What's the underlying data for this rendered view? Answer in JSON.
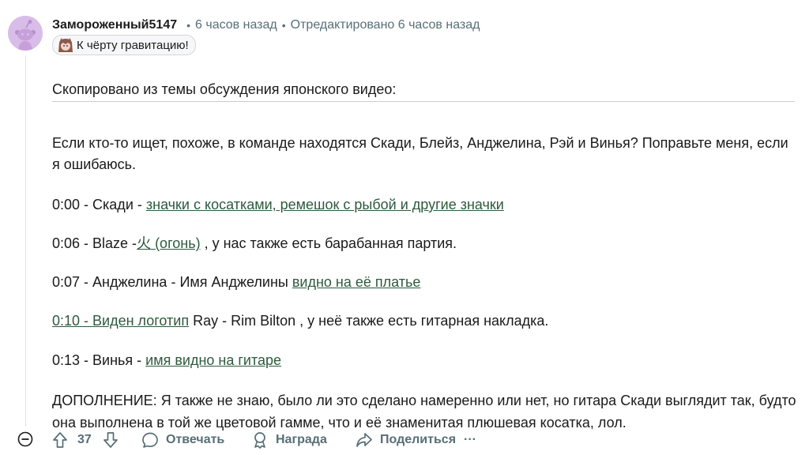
{
  "comment": {
    "username": "Замороженный5147",
    "time": "6 часов назад",
    "separator": "•",
    "edited": "Отредактировано 6 часов назад",
    "flair": "К чёрту гравитацию!",
    "avatar": "reddit-snoo-avatar",
    "flair_emoji": "anime-character-emoji"
  },
  "body": {
    "intro": "Скопировано из темы обсуждения японского видео:",
    "para_main": "Если кто-то ищет, похоже, в команде находятся Скади, Блейз, Анджелина, Рэй и Винья? Поправьте меня, если я ошибаюсь.",
    "line1_prefix": "0:00 - Скади - ",
    "line1_link": "значки с косатками, ремешок с рыбой и другие значки",
    "line2_prefix": "0:06 - Blaze -",
    "line2_link": "火 (огонь)",
    "line2_suffix": " , у нас также есть барабанная партия.",
    "line3_prefix": "0:07 - Анджелина - Имя Анджелины ",
    "line3_link": "видно на её платье",
    "line4_link": "0:10 - Виден логотип",
    "line4_suffix": " Ray - Rim Bilton , у неё также есть гитарная накладка.",
    "line5_prefix": "0:13 - Винья - ",
    "line5_link": "имя видно на гитаре",
    "addendum": "ДОПОЛНЕНИЕ: Я также не знаю, было ли это сделано намеренно или нет, но гитара Скади выглядит так, будто она выполнена в той же цветовой гамме, что и её знаменитая плюшевая косатка, лол."
  },
  "actions": {
    "votes": "37",
    "reply": "Отвечать",
    "award": "Награда",
    "share": "Поделиться",
    "more": "···"
  },
  "colors": {
    "link": "#2d5a3d",
    "meta": "#576f76",
    "avatar_bg": "#d7b8e8"
  }
}
